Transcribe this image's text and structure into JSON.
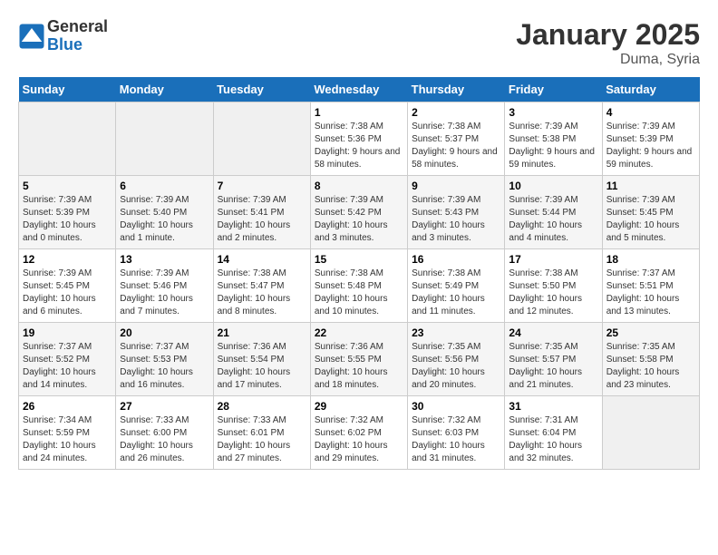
{
  "header": {
    "logo_general": "General",
    "logo_blue": "Blue",
    "month_title": "January 2025",
    "location": "Duma, Syria"
  },
  "days_of_week": [
    "Sunday",
    "Monday",
    "Tuesday",
    "Wednesday",
    "Thursday",
    "Friday",
    "Saturday"
  ],
  "weeks": [
    [
      {
        "day": "",
        "sunrise": "",
        "sunset": "",
        "daylight": ""
      },
      {
        "day": "",
        "sunrise": "",
        "sunset": "",
        "daylight": ""
      },
      {
        "day": "",
        "sunrise": "",
        "sunset": "",
        "daylight": ""
      },
      {
        "day": "1",
        "sunrise": "Sunrise: 7:38 AM",
        "sunset": "Sunset: 5:36 PM",
        "daylight": "Daylight: 9 hours and 58 minutes."
      },
      {
        "day": "2",
        "sunrise": "Sunrise: 7:38 AM",
        "sunset": "Sunset: 5:37 PM",
        "daylight": "Daylight: 9 hours and 58 minutes."
      },
      {
        "day": "3",
        "sunrise": "Sunrise: 7:39 AM",
        "sunset": "Sunset: 5:38 PM",
        "daylight": "Daylight: 9 hours and 59 minutes."
      },
      {
        "day": "4",
        "sunrise": "Sunrise: 7:39 AM",
        "sunset": "Sunset: 5:39 PM",
        "daylight": "Daylight: 9 hours and 59 minutes."
      }
    ],
    [
      {
        "day": "5",
        "sunrise": "Sunrise: 7:39 AM",
        "sunset": "Sunset: 5:39 PM",
        "daylight": "Daylight: 10 hours and 0 minutes."
      },
      {
        "day": "6",
        "sunrise": "Sunrise: 7:39 AM",
        "sunset": "Sunset: 5:40 PM",
        "daylight": "Daylight: 10 hours and 1 minute."
      },
      {
        "day": "7",
        "sunrise": "Sunrise: 7:39 AM",
        "sunset": "Sunset: 5:41 PM",
        "daylight": "Daylight: 10 hours and 2 minutes."
      },
      {
        "day": "8",
        "sunrise": "Sunrise: 7:39 AM",
        "sunset": "Sunset: 5:42 PM",
        "daylight": "Daylight: 10 hours and 3 minutes."
      },
      {
        "day": "9",
        "sunrise": "Sunrise: 7:39 AM",
        "sunset": "Sunset: 5:43 PM",
        "daylight": "Daylight: 10 hours and 3 minutes."
      },
      {
        "day": "10",
        "sunrise": "Sunrise: 7:39 AM",
        "sunset": "Sunset: 5:44 PM",
        "daylight": "Daylight: 10 hours and 4 minutes."
      },
      {
        "day": "11",
        "sunrise": "Sunrise: 7:39 AM",
        "sunset": "Sunset: 5:45 PM",
        "daylight": "Daylight: 10 hours and 5 minutes."
      }
    ],
    [
      {
        "day": "12",
        "sunrise": "Sunrise: 7:39 AM",
        "sunset": "Sunset: 5:45 PM",
        "daylight": "Daylight: 10 hours and 6 minutes."
      },
      {
        "day": "13",
        "sunrise": "Sunrise: 7:39 AM",
        "sunset": "Sunset: 5:46 PM",
        "daylight": "Daylight: 10 hours and 7 minutes."
      },
      {
        "day": "14",
        "sunrise": "Sunrise: 7:38 AM",
        "sunset": "Sunset: 5:47 PM",
        "daylight": "Daylight: 10 hours and 8 minutes."
      },
      {
        "day": "15",
        "sunrise": "Sunrise: 7:38 AM",
        "sunset": "Sunset: 5:48 PM",
        "daylight": "Daylight: 10 hours and 10 minutes."
      },
      {
        "day": "16",
        "sunrise": "Sunrise: 7:38 AM",
        "sunset": "Sunset: 5:49 PM",
        "daylight": "Daylight: 10 hours and 11 minutes."
      },
      {
        "day": "17",
        "sunrise": "Sunrise: 7:38 AM",
        "sunset": "Sunset: 5:50 PM",
        "daylight": "Daylight: 10 hours and 12 minutes."
      },
      {
        "day": "18",
        "sunrise": "Sunrise: 7:37 AM",
        "sunset": "Sunset: 5:51 PM",
        "daylight": "Daylight: 10 hours and 13 minutes."
      }
    ],
    [
      {
        "day": "19",
        "sunrise": "Sunrise: 7:37 AM",
        "sunset": "Sunset: 5:52 PM",
        "daylight": "Daylight: 10 hours and 14 minutes."
      },
      {
        "day": "20",
        "sunrise": "Sunrise: 7:37 AM",
        "sunset": "Sunset: 5:53 PM",
        "daylight": "Daylight: 10 hours and 16 minutes."
      },
      {
        "day": "21",
        "sunrise": "Sunrise: 7:36 AM",
        "sunset": "Sunset: 5:54 PM",
        "daylight": "Daylight: 10 hours and 17 minutes."
      },
      {
        "day": "22",
        "sunrise": "Sunrise: 7:36 AM",
        "sunset": "Sunset: 5:55 PM",
        "daylight": "Daylight: 10 hours and 18 minutes."
      },
      {
        "day": "23",
        "sunrise": "Sunrise: 7:35 AM",
        "sunset": "Sunset: 5:56 PM",
        "daylight": "Daylight: 10 hours and 20 minutes."
      },
      {
        "day": "24",
        "sunrise": "Sunrise: 7:35 AM",
        "sunset": "Sunset: 5:57 PM",
        "daylight": "Daylight: 10 hours and 21 minutes."
      },
      {
        "day": "25",
        "sunrise": "Sunrise: 7:35 AM",
        "sunset": "Sunset: 5:58 PM",
        "daylight": "Daylight: 10 hours and 23 minutes."
      }
    ],
    [
      {
        "day": "26",
        "sunrise": "Sunrise: 7:34 AM",
        "sunset": "Sunset: 5:59 PM",
        "daylight": "Daylight: 10 hours and 24 minutes."
      },
      {
        "day": "27",
        "sunrise": "Sunrise: 7:33 AM",
        "sunset": "Sunset: 6:00 PM",
        "daylight": "Daylight: 10 hours and 26 minutes."
      },
      {
        "day": "28",
        "sunrise": "Sunrise: 7:33 AM",
        "sunset": "Sunset: 6:01 PM",
        "daylight": "Daylight: 10 hours and 27 minutes."
      },
      {
        "day": "29",
        "sunrise": "Sunrise: 7:32 AM",
        "sunset": "Sunset: 6:02 PM",
        "daylight": "Daylight: 10 hours and 29 minutes."
      },
      {
        "day": "30",
        "sunrise": "Sunrise: 7:32 AM",
        "sunset": "Sunset: 6:03 PM",
        "daylight": "Daylight: 10 hours and 31 minutes."
      },
      {
        "day": "31",
        "sunrise": "Sunrise: 7:31 AM",
        "sunset": "Sunset: 6:04 PM",
        "daylight": "Daylight: 10 hours and 32 minutes."
      },
      {
        "day": "",
        "sunrise": "",
        "sunset": "",
        "daylight": ""
      }
    ]
  ]
}
